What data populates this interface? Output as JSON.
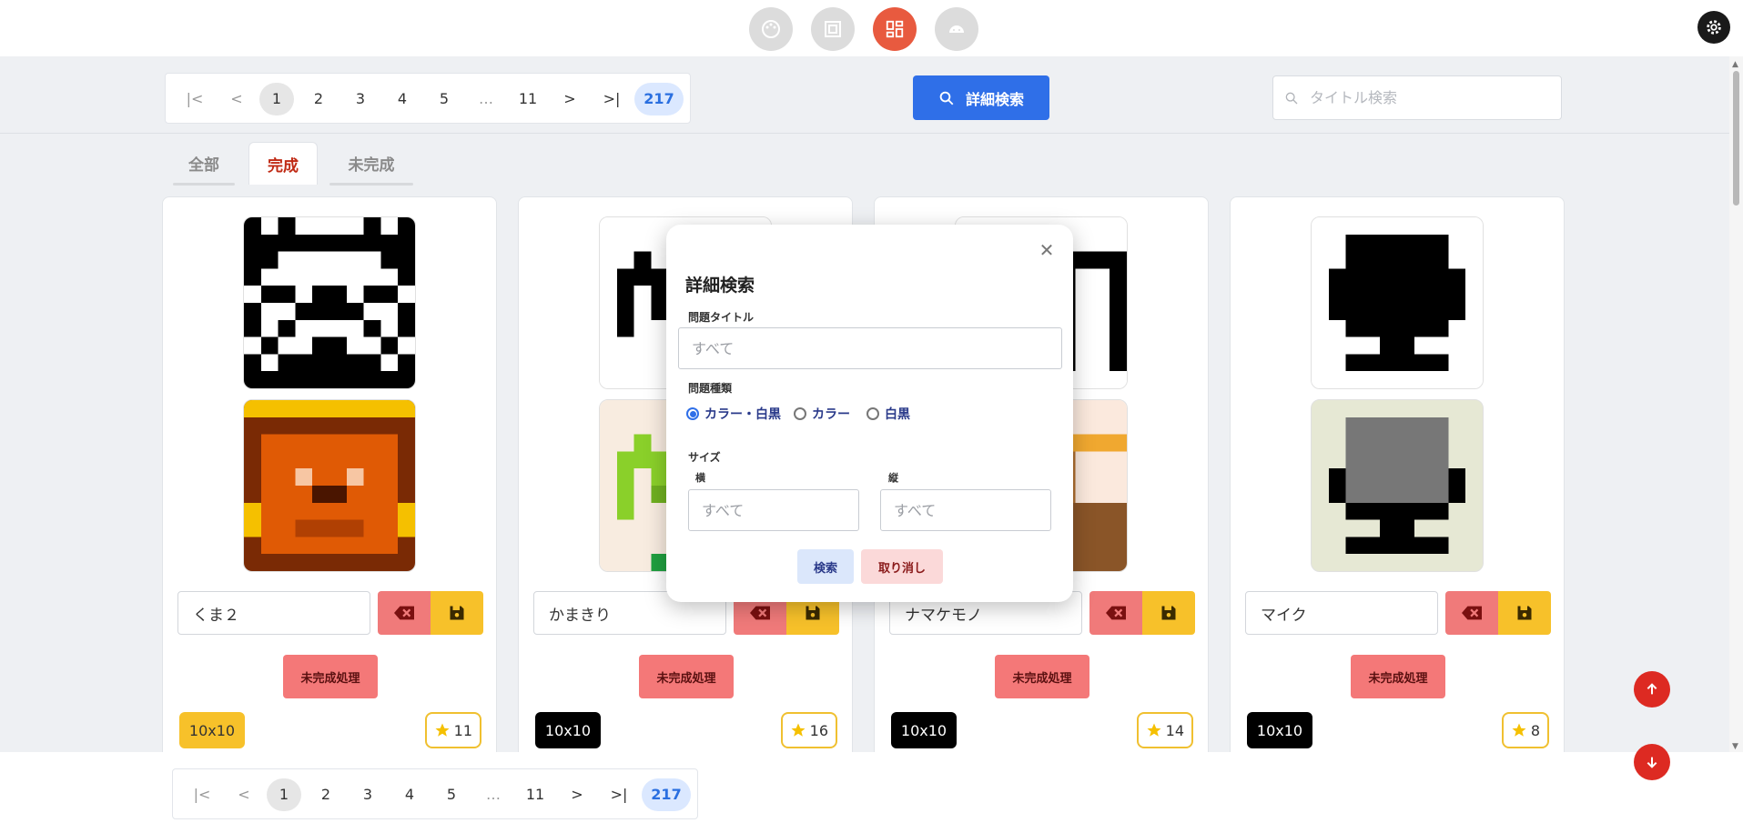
{
  "nav": {
    "icons": [
      "palette-icon",
      "gallery-icon",
      "dashboard-icon",
      "android-icon"
    ],
    "active_index": 2
  },
  "pagination": {
    "pages": [
      "1",
      "2",
      "3",
      "4",
      "5",
      "…",
      "11"
    ],
    "current": "1",
    "last": "217"
  },
  "toolbar": {
    "advanced_search_label": "詳細検索",
    "title_search_placeholder": "タイトル検索"
  },
  "tabs": [
    {
      "label": "全部",
      "active": false
    },
    {
      "label": "完成",
      "active": true
    },
    {
      "label": "未完成",
      "active": false
    }
  ],
  "cards": [
    {
      "name": "くま２",
      "size": "10x10",
      "stars": "11",
      "incomplete_label": "未完成処理",
      "size_badge_color": "#f7c12a"
    },
    {
      "name": "かまきり",
      "size": "10x10",
      "stars": "16",
      "incomplete_label": "未完成処理",
      "size_badge_color": "#000000"
    },
    {
      "name": "ナマケモノ",
      "size": "10x10",
      "stars": "14",
      "incomplete_label": "未完成処理",
      "size_badge_color": "#000000"
    },
    {
      "name": "マイク",
      "size": "10x10",
      "stars": "8",
      "incomplete_label": "未完成処理",
      "size_badge_color": "#000000"
    }
  ],
  "modal": {
    "title": "詳細検索",
    "problem_title_label": "問題タイトル",
    "problem_title_placeholder": "すべて",
    "problem_type_label": "問題種類",
    "type_options": [
      "カラー・白黒",
      "カラー",
      "白黒"
    ],
    "type_selected": "カラー・白黒",
    "size_label": "サイズ",
    "width_label": "横",
    "height_label": "縦",
    "width_placeholder": "すべて",
    "height_placeholder": "すべて",
    "search_label": "検索",
    "cancel_label": "取り消し"
  },
  "colors": {
    "accent": "#2f6fe8",
    "active_nav": "#e85a3f",
    "danger": "#dd2a22",
    "save": "#f7c12a"
  }
}
